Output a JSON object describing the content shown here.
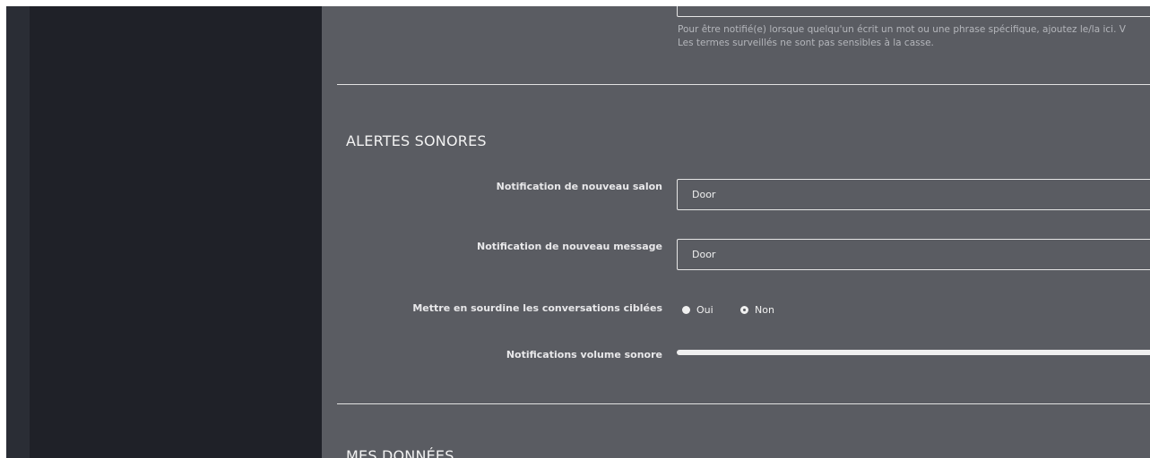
{
  "help": {
    "line1": "Pour être notifié(e) lorsque quelqu'un écrit un mot ou une phrase spécifique, ajoutez le/la ici. V",
    "line2": "Les termes surveillés ne sont pas sensibles à la casse."
  },
  "sound_alerts": {
    "title": "ALERTES SONORES",
    "new_room_label": "Notification de nouveau salon",
    "new_room_value": "Door",
    "new_message_label": "Notification de nouveau message",
    "new_message_value": "Door",
    "mute_label": "Mettre en sourdine les conversations ciblées",
    "mute_options": [
      "Oui",
      "Non"
    ],
    "mute_selected": "Non",
    "volume_label": "Notifications volume sonore",
    "volume_level": 1.0
  },
  "my_data": {
    "title": "MES DONNÉES"
  }
}
